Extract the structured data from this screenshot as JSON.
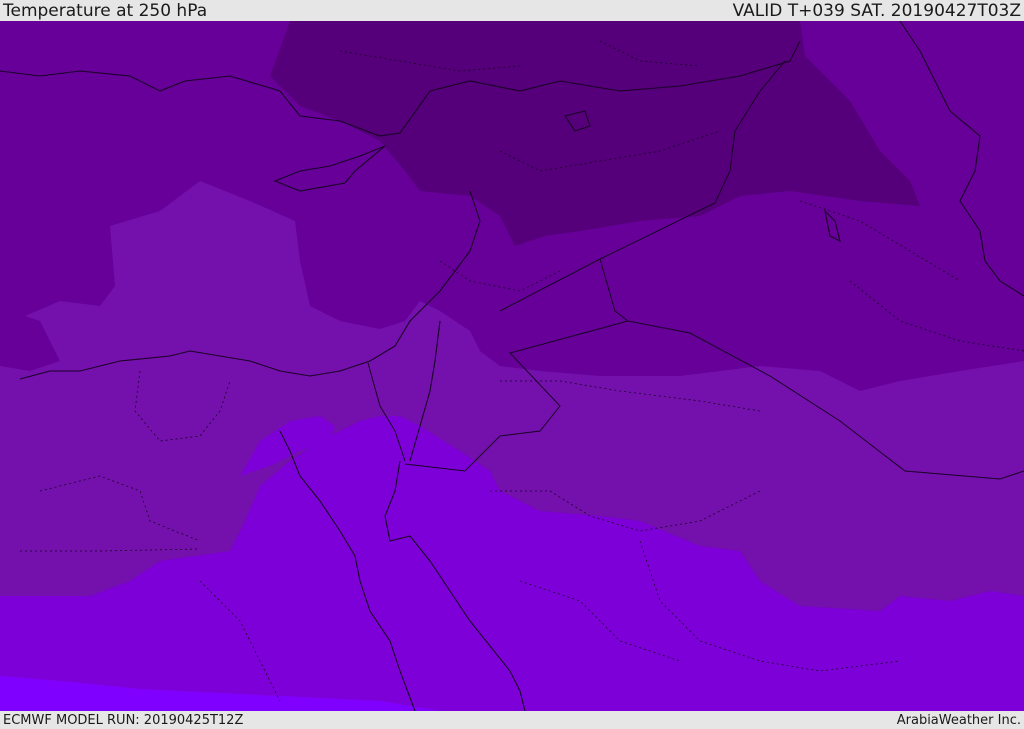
{
  "header": {
    "title": "Temperature at 250 hPa",
    "valid_time": "VALID T+039 SAT. 20190427T03Z"
  },
  "footer": {
    "model_run": "ECMWF MODEL RUN: 20190425T12Z",
    "credit": "ArabiaWeather Inc."
  },
  "map": {
    "colors": {
      "coldest": "#55007a",
      "cold": "#660099",
      "cool": "#7411ac",
      "mild": "#7e00d8",
      "warm": "#8000ff"
    }
  }
}
